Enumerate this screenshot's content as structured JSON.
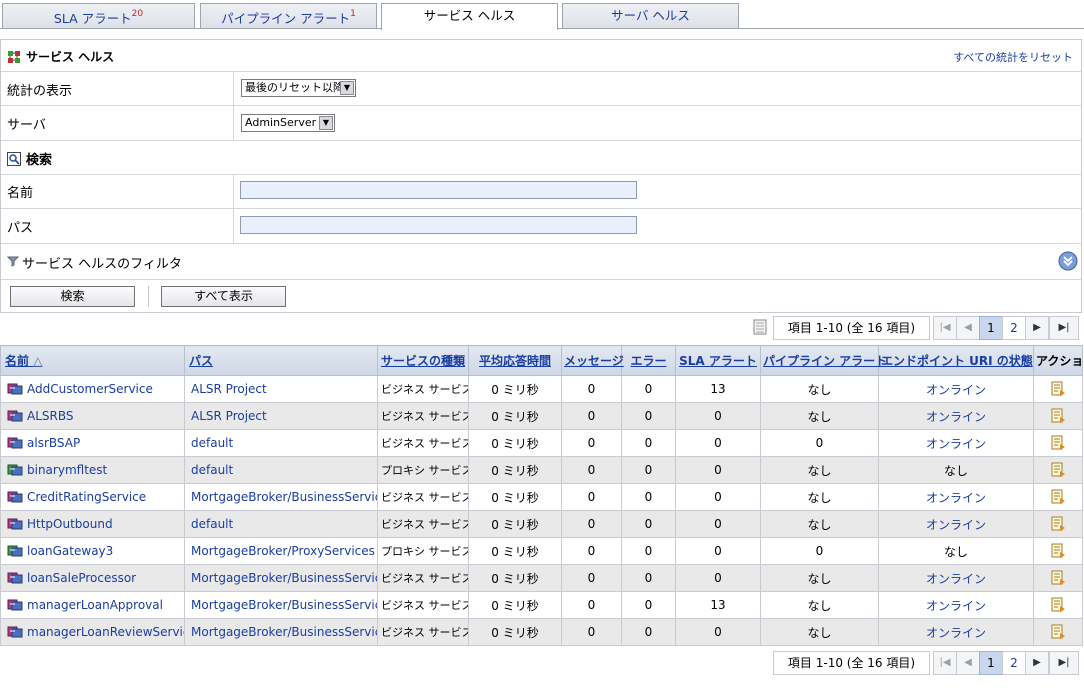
{
  "tabs": [
    {
      "label": "SLA アラート",
      "badge": "20"
    },
    {
      "label": "パイプライン アラート",
      "badge": "1"
    },
    {
      "label": "サービス ヘルス",
      "badge": ""
    },
    {
      "label": "サーバ ヘルス",
      "badge": ""
    }
  ],
  "panel": {
    "title": "サービス ヘルス",
    "reset_link": "すべての統計をリセット",
    "stats_label": "統計の表示",
    "stats_value": "最後のリセット以降",
    "server_label": "サーバ",
    "server_value": "AdminServer",
    "search_title": "検索",
    "name_label": "名前",
    "path_label": "パス",
    "name_value": "",
    "path_value": "",
    "filter_label": "サービス ヘルスのフィルタ",
    "search_button": "検索",
    "show_all_button": "すべて表示"
  },
  "pager": {
    "info": "項目 1-10 (全 16 項目)",
    "pages": [
      "1",
      "2"
    ],
    "current_page": "1"
  },
  "table": {
    "headers": [
      "名前",
      "パス",
      "サービスの種類",
      "平均応答時間",
      "メッセージ",
      "エラー",
      "SLA アラート",
      "パイプライン アラート",
      "エンドポイント URI の状態",
      "アクション"
    ],
    "sort_indicator": "△",
    "rows": [
      {
        "name": "AddCustomerService",
        "path": "ALSR Project",
        "type": "ビジネス サービス",
        "avg": "0 ミリ秒",
        "msg": "0",
        "err": "0",
        "sla": "13",
        "pipe": "なし",
        "uri": "オンライン"
      },
      {
        "name": "ALSRBS",
        "path": "ALSR Project",
        "type": "ビジネス サービス",
        "avg": "0 ミリ秒",
        "msg": "0",
        "err": "0",
        "sla": "0",
        "pipe": "なし",
        "uri": "オンライン"
      },
      {
        "name": "alsrBSAP",
        "path": "default",
        "type": "ビジネス サービス",
        "avg": "0 ミリ秒",
        "msg": "0",
        "err": "0",
        "sla": "0",
        "pipe": "0",
        "uri": "オンライン"
      },
      {
        "name": "binarymfltest",
        "path": "default",
        "type": "プロキシ サービス",
        "avg": "0 ミリ秒",
        "msg": "0",
        "err": "0",
        "sla": "0",
        "pipe": "なし",
        "uri": "なし"
      },
      {
        "name": "CreditRatingService",
        "path": "MortgageBroker/BusinessServices",
        "type": "ビジネス サービス",
        "avg": "0 ミリ秒",
        "msg": "0",
        "err": "0",
        "sla": "0",
        "pipe": "なし",
        "uri": "オンライン"
      },
      {
        "name": "HttpOutbound",
        "path": "default",
        "type": "ビジネス サービス",
        "avg": "0 ミリ秒",
        "msg": "0",
        "err": "0",
        "sla": "0",
        "pipe": "なし",
        "uri": "オンライン"
      },
      {
        "name": "loanGateway3",
        "path": "MortgageBroker/ProxyServices",
        "type": "プロキシ サービス",
        "avg": "0 ミリ秒",
        "msg": "0",
        "err": "0",
        "sla": "0",
        "pipe": "0",
        "uri": "なし"
      },
      {
        "name": "loanSaleProcessor",
        "path": "MortgageBroker/BusinessServices",
        "type": "ビジネス サービス",
        "avg": "0 ミリ秒",
        "msg": "0",
        "err": "0",
        "sla": "0",
        "pipe": "なし",
        "uri": "オンライン"
      },
      {
        "name": "managerLoanApproval",
        "path": "MortgageBroker/BusinessService",
        "type": "ビジネス サービス",
        "avg": "0 ミリ秒",
        "msg": "0",
        "err": "0",
        "sla": "13",
        "pipe": "なし",
        "uri": "オンライン"
      },
      {
        "name": "managerLoanReviewService",
        "path": "MortgageBroker/BusinessServices",
        "type": "ビジネス サービス",
        "avg": "0 ミリ秒",
        "msg": "0",
        "err": "0",
        "sla": "0",
        "pipe": "なし",
        "uri": "オンライン"
      }
    ]
  },
  "colors": {
    "link": "#1a3da0",
    "badge": "#d02020",
    "header_bg": "#cfd8e7",
    "alt_row": "#e9e9ea"
  },
  "icons": [
    "service-health-icon",
    "search-section-icon",
    "filter-icon",
    "expand-chevron-icon",
    "table-settings-icon",
    "business-service-icon",
    "proxy-service-icon",
    "action-icon"
  ]
}
